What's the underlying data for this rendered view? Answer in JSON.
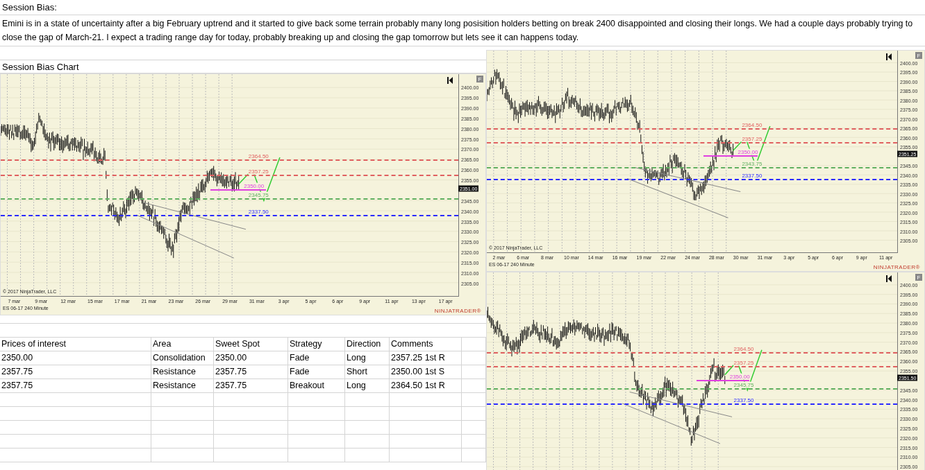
{
  "sheet": {
    "title": "Session Bias:",
    "paragraph": "Emini is in a state of uncertainty after a big February uptrend and it started to give back some terrain probably many long posisition holders betting on break 2400 disappointed and closing their longs. We had a couple days probably trying to close the gap of March-21. I expect a trading range day for today, probably breaking up and closing the gap tomorrow but lets see it can happens today.",
    "chart_label": "Session Bias Chart"
  },
  "charts": [
    {
      "corner_button": "F",
      "current_price": "2351.00",
      "price_ticks": [
        "2400.00",
        "2395.00",
        "2390.00",
        "2385.00",
        "2380.00",
        "2375.00",
        "2370.00",
        "2365.00",
        "2360.00",
        "2355.00",
        "2345.00",
        "2340.00",
        "2335.00",
        "2330.00",
        "2325.00",
        "2320.00",
        "2315.00",
        "2310.00",
        "2305.00"
      ],
      "levels": [
        {
          "label": "2364.50",
          "color": "#e06060"
        },
        {
          "label": "2357.25",
          "color": "#e06060"
        },
        {
          "label": "2350.00",
          "color": "#e040e0"
        },
        {
          "label": "2345.75",
          "color": "#60b060"
        },
        {
          "label": "2337.50",
          "color": "#2a2aff"
        }
      ],
      "dates": [
        "7 mar",
        "9 mar",
        "12 mar",
        "15 mar",
        "17 mar",
        "21 mar",
        "23 mar",
        "26 mar",
        "29 mar",
        "31 mar",
        "3 apr",
        "5 apr",
        "6 apr",
        "9 apr",
        "11 apr",
        "13 apr",
        "17 apr"
      ],
      "copyright": "© 2017 NinjaTrader, LLC",
      "instrument": "ES 06-17 240 Minute",
      "logo": "NINJATRADER®"
    },
    {
      "corner_button": "F",
      "current_price": "2351.25",
      "price_ticks": [
        "2400.00",
        "2395.00",
        "2390.00",
        "2385.00",
        "2380.00",
        "2375.00",
        "2370.00",
        "2365.00",
        "2360.00",
        "2355.00",
        "2345.00",
        "2340.00",
        "2335.00",
        "2330.00",
        "2325.00",
        "2320.00",
        "2315.00",
        "2310.00",
        "2305.00"
      ],
      "levels": [
        {
          "label": "2364.50",
          "color": "#e06060"
        },
        {
          "label": "2357.25",
          "color": "#e06060"
        },
        {
          "label": "2350.00",
          "color": "#e040e0"
        },
        {
          "label": "2343.75",
          "color": "#60b060"
        },
        {
          "label": "2337.50",
          "color": "#2a2aff"
        }
      ],
      "dates": [
        "2 mar",
        "6 mar",
        "8 mar",
        "10 mar",
        "14 mar",
        "16 mar",
        "19 mar",
        "22 mar",
        "24 mar",
        "28 mar",
        "30 mar",
        "31 mar",
        "3 apr",
        "5 apr",
        "6 apr",
        "9 apr",
        "11 apr"
      ],
      "copyright": "© 2017 NinjaTrader, LLC",
      "instrument": "ES 06-17 240 Minute",
      "logo": "NINJATRADER®"
    },
    {
      "corner_button": "F",
      "current_price": "2351.50",
      "price_ticks": [
        "2400.00",
        "2395.00",
        "2390.00",
        "2385.00",
        "2380.00",
        "2375.00",
        "2370.00",
        "2365.00",
        "2360.00",
        "2355.00",
        "2345.00",
        "2340.00",
        "2335.00",
        "2330.00",
        "2325.00",
        "2320.00",
        "2315.00",
        "2310.00",
        "2305.00"
      ],
      "levels": [
        {
          "label": "2364.50",
          "color": "#e06060"
        },
        {
          "label": "2357.25",
          "color": "#e06060"
        },
        {
          "label": "2350.00",
          "color": "#e040e0"
        },
        {
          "label": "2345.75",
          "color": "#60b060"
        },
        {
          "label": "2337.50",
          "color": "#2a2aff"
        }
      ]
    }
  ],
  "table": {
    "columns": [
      "Prices of interest",
      "Area",
      "Sweet Spot",
      "Strategy",
      "Direction",
      "Comments"
    ],
    "rows": [
      [
        "2350.00",
        "Consolidation",
        "2350.00",
        "Fade",
        "Long",
        "2357.25 1st R"
      ],
      [
        "2357.75",
        "Resistance",
        "2357.75",
        "Fade",
        "Short",
        "2350.00 1st S"
      ],
      [
        "2357.75",
        "Resistance",
        "2357.75",
        "Breakout",
        "Long",
        "2364.50 1st R"
      ]
    ]
  }
}
